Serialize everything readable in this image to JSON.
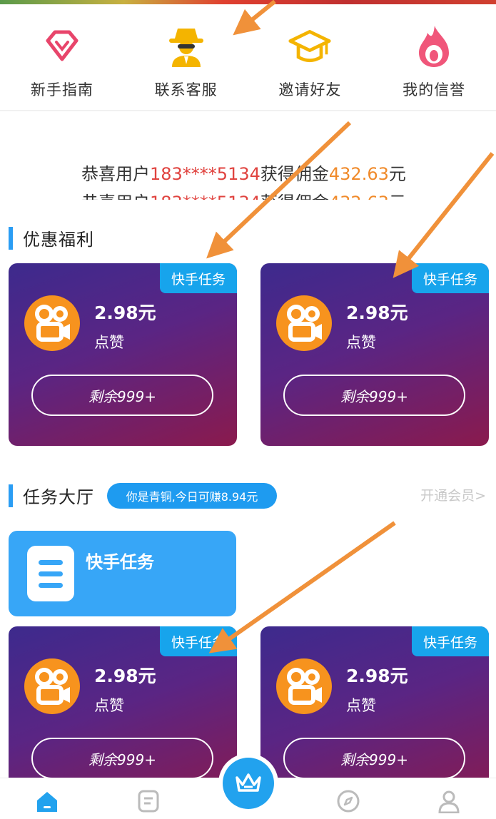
{
  "menu": [
    {
      "label": "新手指南",
      "icon": "diamond-icon"
    },
    {
      "label": "联系客服",
      "icon": "agent-icon"
    },
    {
      "label": "邀请好友",
      "icon": "graduation-cap-icon"
    },
    {
      "label": "我的信誉",
      "icon": "flame-icon"
    }
  ],
  "ticker": {
    "line1": {
      "prefix": "恭喜用户",
      "phone": "183****5134",
      "mid": "获得佣金",
      "amount": "432.63",
      "suffix": "元"
    }
  },
  "section_welfare": {
    "title": "优惠福利"
  },
  "section_tasks": {
    "title": "任务大厅",
    "badge": "你是青铜,今日可赚8.94元",
    "vip_link": "开通会员>"
  },
  "task_hall": {
    "label": "快手任务"
  },
  "cards": [
    {
      "tag": "快手任务",
      "price": "2.98元",
      "action": "点赞",
      "remaining": "剩余999+"
    },
    {
      "tag": "快手任务",
      "price": "2.98元",
      "action": "点赞",
      "remaining": "剩余999+"
    },
    {
      "tag": "快手任务",
      "price": "2.98元",
      "action": "点赞",
      "remaining": "剩余999+"
    },
    {
      "tag": "快手任务",
      "price": "2.98元",
      "action": "点赞",
      "remaining": "剩余999+"
    }
  ],
  "tabbar": [
    "home-icon",
    "task-list-icon",
    "crown-icon",
    "compass-icon",
    "user-icon"
  ],
  "colors": {
    "accent": "#2a9df4",
    "card_start": "#3d2a8d",
    "card_end": "#8a1a4d",
    "highlight_red": "#e0433f",
    "highlight_orange": "#f08a2a",
    "arrow": "#f0913a"
  }
}
